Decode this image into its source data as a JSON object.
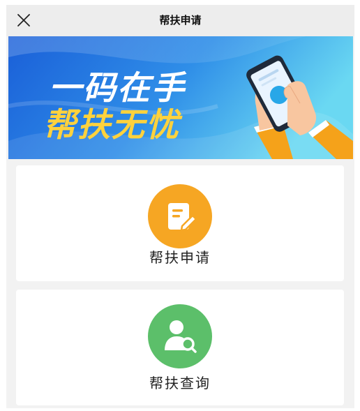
{
  "header": {
    "title": "帮扶申请"
  },
  "banner": {
    "line1": "一码在手",
    "line2": "帮扶无忧"
  },
  "cards": [
    {
      "label": "帮扶申请",
      "icon": "edit-document-icon",
      "color": "#f6a623"
    },
    {
      "label": "帮扶查询",
      "icon": "user-search-icon",
      "color": "#5cbf6a"
    }
  ],
  "colors": {
    "banner_blue": "#1f6fe0",
    "banner_cyan": "#49c8f0",
    "banner_text": "#ffffff",
    "banner_text_yellow": "#ffd23d"
  }
}
